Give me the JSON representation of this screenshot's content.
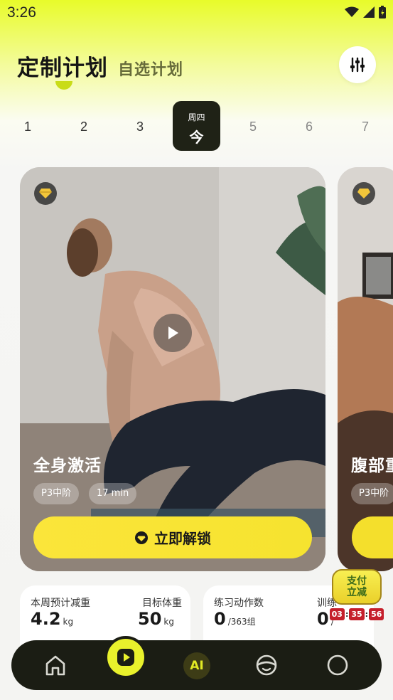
{
  "status_bar": {
    "time": "3:26"
  },
  "header": {
    "title": "定制计划",
    "subtitle": "自选计划"
  },
  "days": {
    "before": [
      "1",
      "2",
      "3"
    ],
    "selected": {
      "weekday": "周四",
      "label": "今"
    },
    "after": [
      "5",
      "6",
      "7"
    ]
  },
  "cards": [
    {
      "title": "全身激活",
      "tags": [
        "P3中阶",
        "17 min"
      ],
      "button": "立即解锁"
    },
    {
      "title": "腹部重",
      "tags": [
        "P3中阶"
      ]
    }
  ],
  "stats": [
    {
      "label": "本周预计减重",
      "value": "4.2",
      "unit": "kg"
    },
    {
      "label": "目标体重",
      "value": "50",
      "unit": "kg"
    },
    {
      "label": "练习动作数",
      "value": "0",
      "unit": "/363组"
    },
    {
      "label": "训练",
      "value": "0",
      "unit": "/"
    }
  ],
  "promo": {
    "line1": "支付",
    "line2": "立减",
    "timer": [
      "03",
      "35",
      "56"
    ]
  },
  "nav": {
    "ai_label": "AI"
  },
  "colors": {
    "accent": "#e9f12c",
    "button_yellow": "#f9e43a",
    "nav_bg": "#1b1d14"
  }
}
